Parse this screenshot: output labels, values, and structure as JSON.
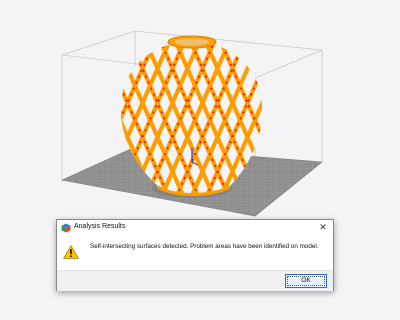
{
  "dialog": {
    "title": "Analysis Results",
    "close_glyph": "✕",
    "message": "Self-intersecting surfaces detected.  Problem areas have been identified on model.",
    "ok_label": "OK",
    "app_icon": "app-cube-icon",
    "warning_icon": "warning-icon"
  },
  "scene": {
    "model_color": "#ffa200",
    "problem_color": "#e81010",
    "plate_color": "#8d8d8d"
  }
}
